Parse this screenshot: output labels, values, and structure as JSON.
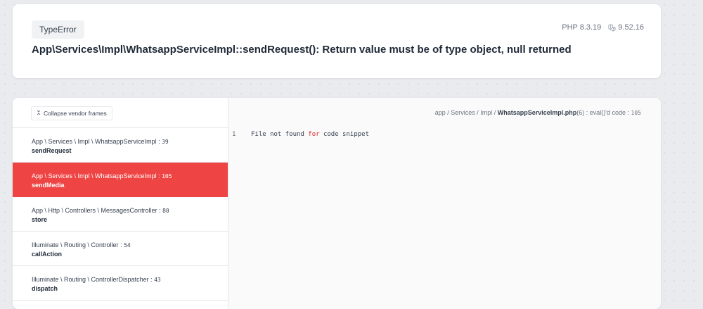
{
  "header": {
    "exception_type": "TypeError",
    "php_version": "PHP 8.3.19",
    "laravel_version": "9.52.16",
    "message": "App\\Services\\Impl\\WhatsappServiceImpl::sendRequest(): Return value must be of type object, null returned"
  },
  "frames_panel": {
    "collapse_label": "Collapse vendor frames",
    "frames": [
      {
        "path": "App \\ Services \\ Impl \\ WhatsappServiceImpl",
        "line": "39",
        "method": "sendRequest"
      },
      {
        "path": "App \\ Services \\ Impl \\ WhatsappServiceImpl",
        "line": "105",
        "method": "sendMedia"
      },
      {
        "path": "App \\ Http \\ Controllers \\ MessagesController",
        "line": "80",
        "method": "store"
      },
      {
        "path": "Illuminate \\ Routing \\ Controller",
        "line": "54",
        "method": "callAction"
      },
      {
        "path": "Illuminate \\ Routing \\ ControllerDispatcher",
        "line": "43",
        "method": "dispatch"
      }
    ]
  },
  "code_panel": {
    "file_path": "app / Services / Impl / ",
    "file_name": "WhatsappServiceImpl.php",
    "file_suffix": "(6) : eval()'d code",
    "file_line": "105",
    "line_number": "1",
    "code_before": "File not found ",
    "code_keyword": "for",
    "code_after": " code snippet"
  },
  "colors": {
    "active_frame": "#ef4444",
    "keyword": "#dc2626"
  }
}
